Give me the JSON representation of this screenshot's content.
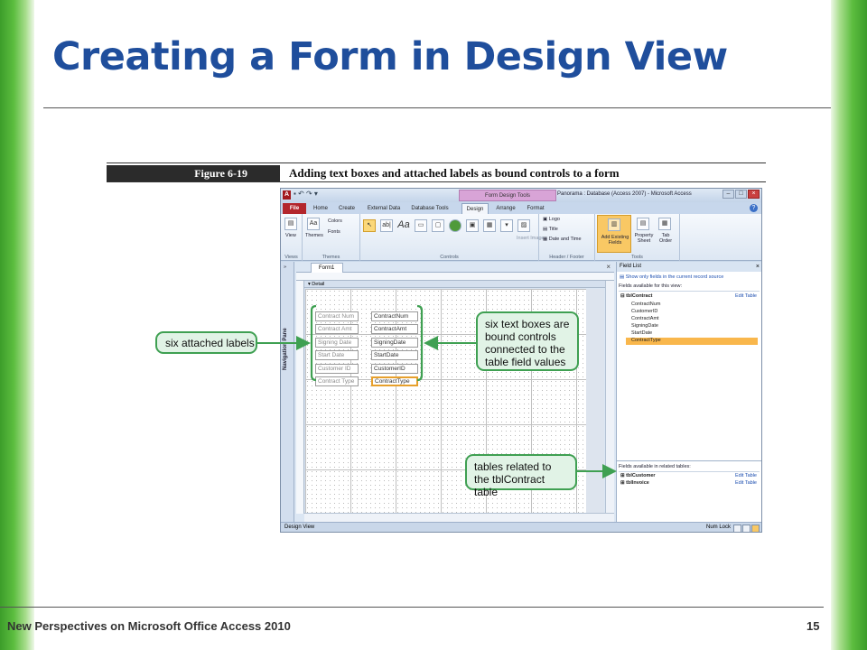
{
  "slide": {
    "title": "Creating a Form in Design View",
    "footer": "New Perspectives on Microsoft Office Access 2010",
    "page_number": "15"
  },
  "figure": {
    "label": "Figure 6-19",
    "caption": "Adding text boxes and attached labels as bound controls to a form"
  },
  "access": {
    "app_icon": "A",
    "context_tab": "Form Design Tools",
    "window_title": "Panorama : Database (Access 2007) - Microsoft Access",
    "tabs": [
      "File",
      "Home",
      "Create",
      "External Data",
      "Database Tools",
      "Design",
      "Arrange",
      "Format"
    ],
    "active_tab": "Design",
    "ribbon": {
      "views_button": "View",
      "views_group": "Views",
      "themes_button": "Themes",
      "colors_button": "Colors",
      "fonts_button": "Fonts",
      "themes_group": "Themes",
      "controls_group": "Controls",
      "insert_image": "Insert Image",
      "logo": "Logo",
      "title": "Title",
      "date_time": "Date and Time",
      "header_footer_group": "Header / Footer",
      "add_existing_fields": "Add Existing Fields",
      "property_sheet": "Property Sheet",
      "tab_order": "Tab Order",
      "tools_group": "Tools"
    },
    "nav_pane_label": "Navigation Pane",
    "document_tab": "Form1",
    "section_label": "Detail",
    "labels": [
      "Contract Num",
      "Contract Amt",
      "Signing Date",
      "Start Date",
      "Customer ID",
      "Contract Type"
    ],
    "textboxes": [
      "ContractNum",
      "ContractAmt",
      "SigningDate",
      "StartDate",
      "CustomerID",
      "ContractType"
    ],
    "selected_textbox": "ContractType",
    "field_list": {
      "title": "Field List",
      "show_only_link": "Show only fields in the current record source",
      "available_header": "Fields available for this view:",
      "table": "tblContract",
      "edit_table": "Edit Table",
      "fields": [
        "ContractNum",
        "CustomerID",
        "ContractAmt",
        "SigningDate",
        "StartDate",
        "ContractType"
      ],
      "selected_field": "ContractType",
      "related_header": "Fields available in related tables:",
      "related_tables": [
        "tblCustomer",
        "tblInvoice"
      ]
    },
    "status_left": "Design View",
    "status_right": "Num Lock"
  },
  "callouts": {
    "labels": "six attached labels",
    "textboxes": "six text boxes are bound controls connected to the table field values",
    "related": "tables related to the tblContract table"
  },
  "colors": {
    "title_blue": "#1f4e9c",
    "callout_fill": "#e1f3e6",
    "callout_border": "#3fa052",
    "selection_orange": "#f9b74c",
    "file_tab_red": "#b3262c",
    "context_tab_purple": "#d8a4d7"
  }
}
